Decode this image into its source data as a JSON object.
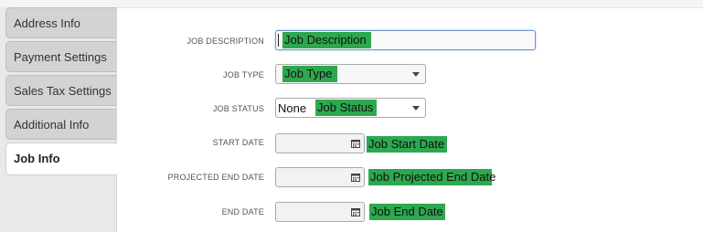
{
  "sidebar": {
    "tabs": [
      {
        "label": "Address Info"
      },
      {
        "label": "Payment Settings"
      },
      {
        "label": "Sales Tax Settings"
      },
      {
        "label": "Additional Info"
      },
      {
        "label": "Job Info"
      }
    ]
  },
  "form": {
    "job_description": {
      "label": "JOB DESCRIPTION",
      "value": "Job Description"
    },
    "job_type": {
      "label": "JOB TYPE",
      "value": "Job Type"
    },
    "job_status": {
      "label": "JOB STATUS",
      "selected": "None",
      "value": "Job Status"
    },
    "start_date": {
      "label": "START DATE",
      "value": "Job Start Date"
    },
    "projected_end_date": {
      "label": "PROJECTED END DATE",
      "value": "Job Projected End Date"
    },
    "end_date": {
      "label": "END DATE",
      "value": "Job End Date"
    }
  },
  "icons": {
    "dropdown": "chevron-down-icon",
    "calendar": "calendar-icon"
  },
  "colors": {
    "highlight": "#2ea84f",
    "focus_border": "#6f96c8"
  }
}
